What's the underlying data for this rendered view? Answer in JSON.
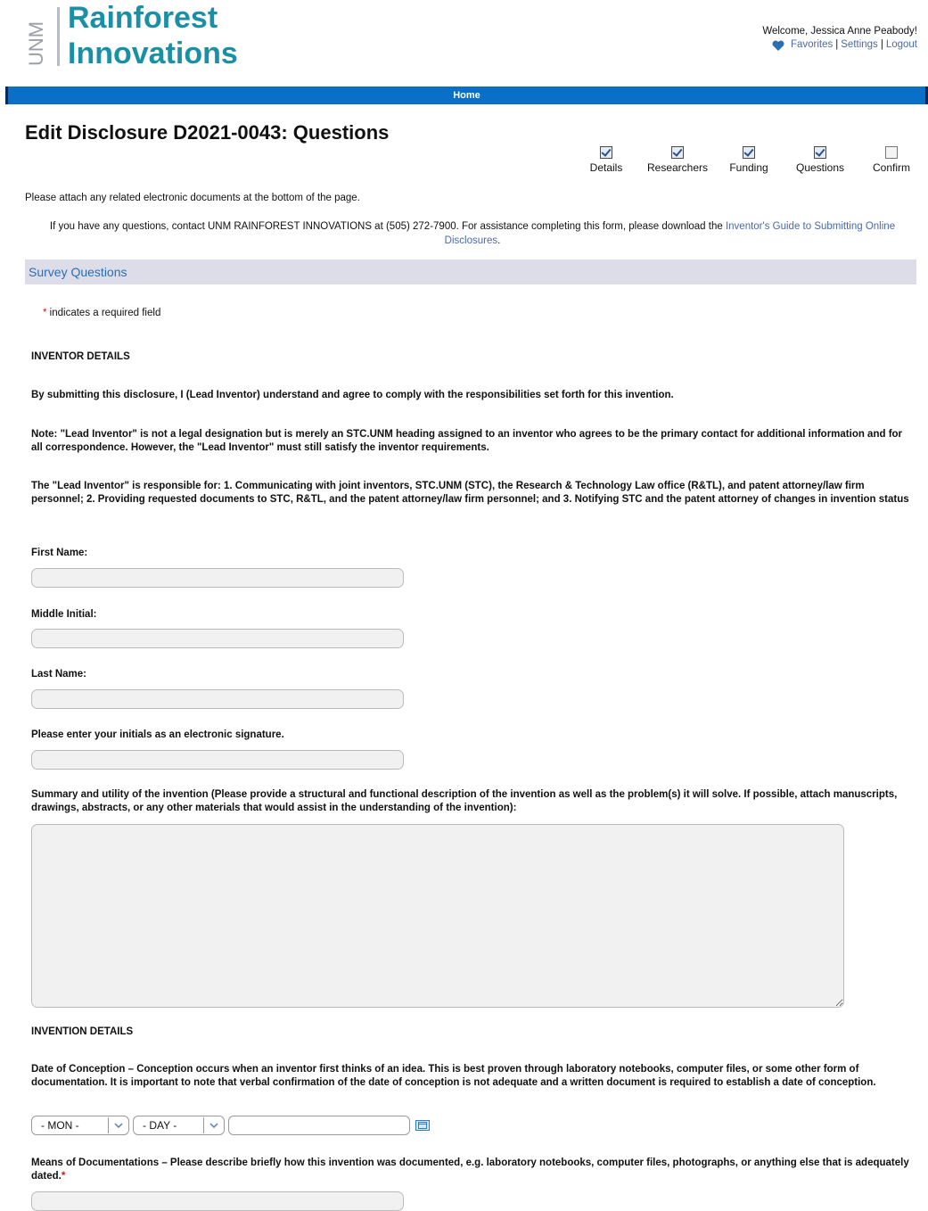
{
  "brand": {
    "unm_text": "UNM",
    "line1": "Rainforest",
    "line2": "Innovations",
    "teal": "#1a8fa6"
  },
  "user": {
    "welcome": "Welcome, Jessica Anne Peabody!",
    "favorites": "Favorites",
    "settings": "Settings",
    "logout": "Logout",
    "sep": "|",
    "heart_icon": "heart-icon",
    "heart_color": "#2a6fb3"
  },
  "nav": {
    "home": "Home",
    "bar_color": "#0a6fc6"
  },
  "page": {
    "title": "Edit Disclosure D2021-0043: Questions"
  },
  "steps": [
    {
      "label": "Details",
      "checked": true
    },
    {
      "label": "Researchers",
      "checked": true
    },
    {
      "label": "Funding",
      "checked": true
    },
    {
      "label": "Questions",
      "checked": true
    },
    {
      "label": "Confirm",
      "checked": false
    }
  ],
  "notes": {
    "attach": "Please attach any related electronic documents at the bottom of the page.",
    "contact_pre": "If you have any questions, contact UNM RAINFOREST INNOVATIONS at (505) 272-7900. For assistance completing this form, please download the ",
    "contact_link": "Inventor's Guide to Submitting Online Disclosures",
    "contact_post": "."
  },
  "section": {
    "title": "Survey Questions"
  },
  "required_note": {
    "star": "*",
    "text": " indicates a required field"
  },
  "inventor": {
    "heading": "INVENTOR DETAILS",
    "agree": "By submitting this disclosure, I (Lead Inventor) understand and agree to comply with the responsibilities set forth for this invention.",
    "note": "Note: \"Lead Inventor\" is not a legal designation but is merely an STC.UNM heading assigned to an inventor who agrees to be the primary contact for additional information and for all correspondence. However, the \"Lead Inventor\" must still satisfy the inventor requirements.",
    "responsible": "The \"Lead Inventor\" is responsible for: 1. Communicating with joint inventors, STC.UNM (STC), the Research & Technology Law office (R&TL), and patent attorney/law firm personnel; 2. Providing requested documents to STC, R&TL, and the patent attorney/law firm personnel; and 3. Notifying STC and the patent attorney of changes in invention status",
    "first_name_label": "First Name:",
    "first_name_value": "",
    "middle_initial_label": "Middle Initial:",
    "middle_initial_value": "",
    "last_name_label": "Last Name:",
    "last_name_value": "",
    "initials_label": "Please enter your initials as an electronic signature.",
    "initials_value": "",
    "summary_label": "Summary and utility of the invention (Please provide a structural and functional description of the invention as well as the problem(s) it will solve. If possible, attach manuscripts, drawings, abstracts, or any other materials that would assist in the understanding of the invention):",
    "summary_value": ""
  },
  "invention": {
    "heading": "INVENTION DETAILS",
    "conception_label": "Date of Conception – Conception occurs when an inventor first thinks of an idea. This is best proven through laboratory notebooks, computer files, or some other form of documentation. It is important to note that verbal confirmation of the date of conception is not adequate and a written document is required to establish a date of conception.",
    "month_select": "- MON -",
    "day_select": "- DAY -",
    "year_value": "",
    "calendar_icon": "calendar-icon",
    "documentation_label": "Means of Documentations – Please describe briefly how this invention was documented, e.g. laboratory notebooks, computer files, photographs, or anything else that is adequately dated.",
    "documentation_required": "*",
    "documentation_value": ""
  }
}
